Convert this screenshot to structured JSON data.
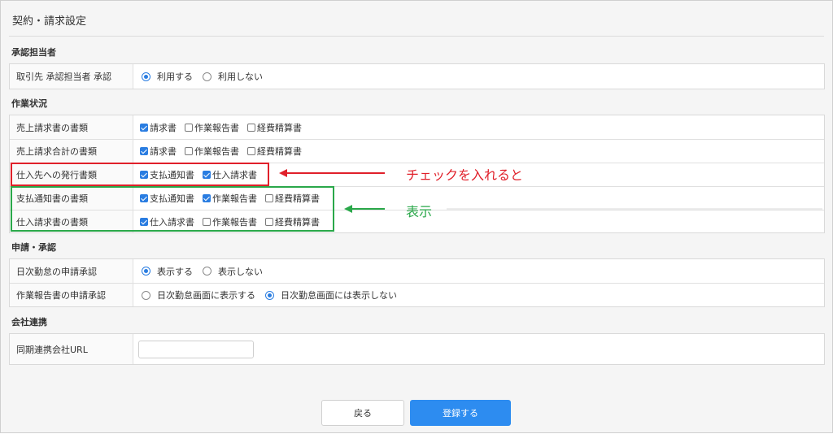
{
  "page": {
    "title": "契約・請求設定"
  },
  "sections": {
    "approver": {
      "title": "承認担当者",
      "rows": [
        {
          "label": "取引先 承認担当者 承認",
          "options": [
            "利用する",
            "利用しない"
          ],
          "selected": 0
        }
      ]
    },
    "work_status": {
      "title": "作業状況",
      "rows": [
        {
          "label": "売上請求書の書類",
          "checks": [
            {
              "label": "請求書",
              "checked": true
            },
            {
              "label": "作業報告書",
              "checked": false
            },
            {
              "label": "経費精算書",
              "checked": false
            }
          ]
        },
        {
          "label": "売上請求合計の書類",
          "checks": [
            {
              "label": "請求書",
              "checked": true
            },
            {
              "label": "作業報告書",
              "checked": false
            },
            {
              "label": "経費精算書",
              "checked": false
            }
          ]
        },
        {
          "label": "仕入先への発行書類",
          "checks": [
            {
              "label": "支払通知書",
              "checked": true
            },
            {
              "label": "仕入請求書",
              "checked": true
            }
          ]
        },
        {
          "label": "支払通知書の書類",
          "checks": [
            {
              "label": "支払通知書",
              "checked": true
            },
            {
              "label": "作業報告書",
              "checked": true
            },
            {
              "label": "経費精算書",
              "checked": false
            }
          ]
        },
        {
          "label": "仕入請求書の書類",
          "checks": [
            {
              "label": "仕入請求書",
              "checked": true
            },
            {
              "label": "作業報告書",
              "checked": false
            },
            {
              "label": "経費精算書",
              "checked": false
            }
          ]
        }
      ]
    },
    "application": {
      "title": "申請・承認",
      "rows": [
        {
          "label": "日次勤怠の申請承認",
          "options": [
            "表示する",
            "表示しない"
          ],
          "selected": 0
        },
        {
          "label": "作業報告書の申請承認",
          "options": [
            "日次勤怠画面に表示する",
            "日次勤怠画面には表示しない"
          ],
          "selected": 1
        }
      ]
    },
    "company_link": {
      "title": "会社連携",
      "rows": [
        {
          "label": "同期連携会社URL",
          "value": "",
          "placeholder": ""
        }
      ]
    }
  },
  "buttons": {
    "back": "戻る",
    "save": "登録する"
  },
  "annotations": {
    "check_note": "チェックを入れると",
    "display_note": "表示",
    "red": "#e0202a",
    "green": "#2aa84a"
  },
  "colors": {
    "accent": "#2d8cf0"
  }
}
